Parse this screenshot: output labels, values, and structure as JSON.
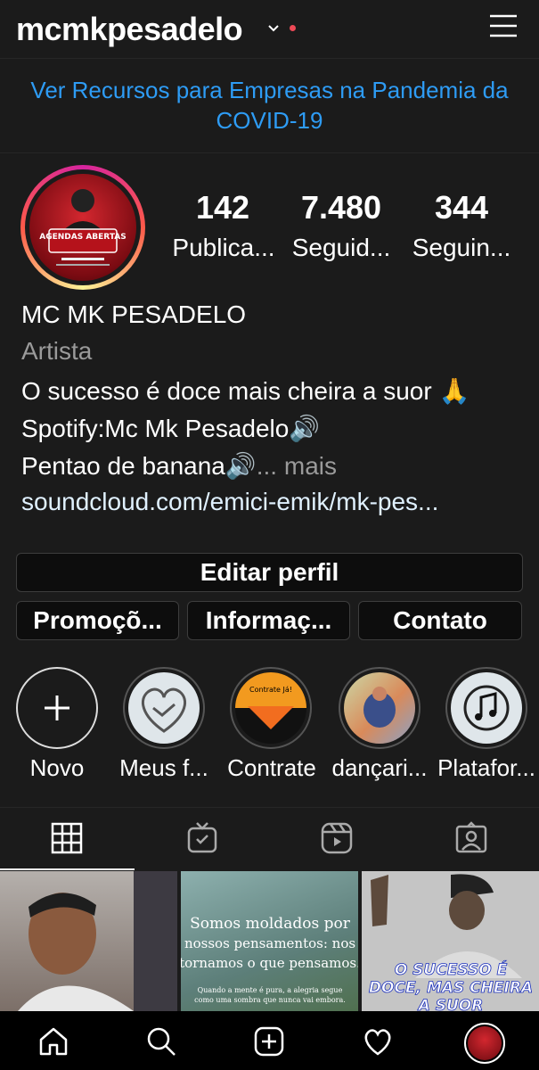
{
  "header": {
    "username": "mcmkpesadelo"
  },
  "promo_banner": "Ver Recursos para Empresas na Pandemia da COVID-19",
  "stats": [
    {
      "value": "142",
      "label": "Publica..."
    },
    {
      "value": "7.480",
      "label": "Seguid..."
    },
    {
      "value": "344",
      "label": "Seguin..."
    }
  ],
  "profile": {
    "name": "MC MK PESADELO",
    "category": "Artista",
    "bio_line1": "O sucesso é doce mais cheira a suor 🙏",
    "bio_line2": "Spotify:Mc Mk Pesadelo🔊",
    "bio_line3": "Pentao de banana🔊",
    "more": "... mais",
    "link": "soundcloud.com/emici-emik/mk-pes..."
  },
  "buttons": {
    "edit_profile": "Editar perfil",
    "promotions": "Promoçõ...",
    "insights": "Informaç...",
    "contact": "Contato"
  },
  "highlights": [
    {
      "label": "Novo",
      "icon": "plus-icon"
    },
    {
      "label": "Meus f...",
      "icon": "handshake-heart-icon"
    },
    {
      "label": "Contrate",
      "icon": "contrate-badge",
      "badge_text": "Contrate Já!"
    },
    {
      "label": "dançari...",
      "icon": "dancer-photo"
    },
    {
      "label": "Platafor...",
      "icon": "music-note-icon"
    }
  ],
  "avatar": {
    "title_text": "AGENDAS ABERTAS"
  },
  "grid_posts": [
    {
      "type": "photo"
    },
    {
      "type": "quote",
      "text_line1": "Somos moldados por",
      "text_line2": "nossos pensamentos: nos",
      "text_line3": "tornamos o que pensamos.",
      "small1": "Quando a mente é pura, a alegria segue",
      "small2": "como uma sombra que nunca vai embora."
    },
    {
      "type": "quote-photo",
      "caption1": "O SUCESSO É",
      "caption2": "DOCE, MAS CHEIRA",
      "caption3": "A SUOR"
    }
  ],
  "colors": {
    "accent": "#2e9cf5",
    "background": "#1b1b1b",
    "notification": "#ed4956"
  }
}
